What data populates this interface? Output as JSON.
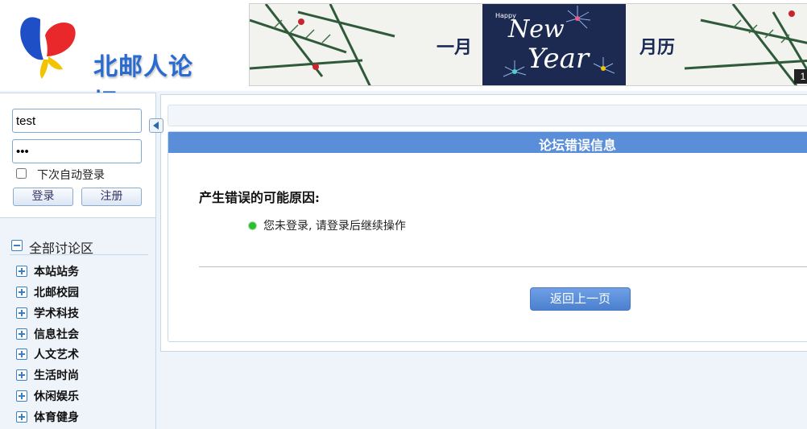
{
  "header": {
    "site_name": "北邮人论坛",
    "banner": {
      "left_text": "一月",
      "right_text": "月历",
      "happy_text": "Happy",
      "new_text": "New",
      "year_text": "Year",
      "page_indicator": "1"
    }
  },
  "sidebar": {
    "login": {
      "username_value": "test",
      "password_value": "•••",
      "remember_label": "下次自动登录",
      "login_label": "登录",
      "register_label": "注册"
    },
    "tree": {
      "root_label": "全部讨论区",
      "items": [
        {
          "label": "本站站务"
        },
        {
          "label": "北邮校园"
        },
        {
          "label": "学术科技"
        },
        {
          "label": "信息社会"
        },
        {
          "label": "人文艺术"
        },
        {
          "label": "生活时尚"
        },
        {
          "label": "休闲娱乐"
        },
        {
          "label": "体育健身"
        }
      ]
    }
  },
  "main": {
    "error_title": "论坛错误信息",
    "reason_heading": "产生错误的可能原因:",
    "reason_text": "您未登录, 请登录后继续操作",
    "back_label": "返回上一页"
  },
  "colors": {
    "accent": "#5b8ed8",
    "bullet": "#2bbf2b",
    "logo_text": "#2a6bd1"
  }
}
